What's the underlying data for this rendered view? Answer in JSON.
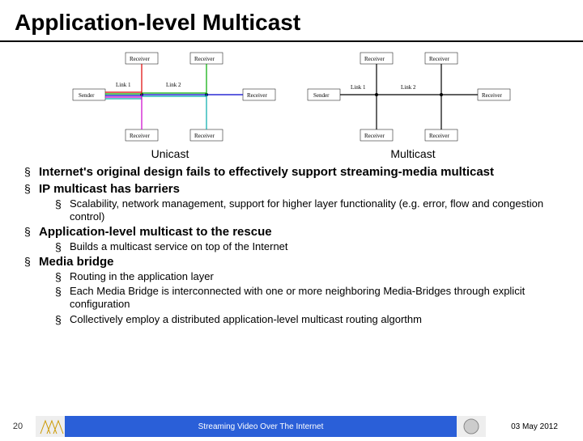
{
  "title": "Application-level Multicast",
  "diagrams": {
    "unicast_caption": "Unicast",
    "multicast_caption": "Multicast",
    "nodes": {
      "sender": "Sender",
      "receiver": "Receiver",
      "link1": "Link 1",
      "link2": "Link 2"
    }
  },
  "bullets": [
    {
      "text": "Internet's original design fails to effectively support streaming-media multicast",
      "children": []
    },
    {
      "text": "IP multicast has barriers",
      "children": [
        {
          "text": "Scalability, network management, support for higher layer functionality (e.g. error, flow and congestion control)"
        }
      ]
    },
    {
      "text": "Application-level multicast to the rescue",
      "children": [
        {
          "text": "Builds a multicast service on top of the Internet"
        }
      ]
    },
    {
      "text": "Media bridge",
      "children": [
        {
          "text": "Routing in the application layer"
        },
        {
          "text": "Each Media Bridge is interconnected with one or more neighboring Media-Bridges through explicit configuration"
        },
        {
          "text": "Collectively employ a distributed application-level multicast routing algorthm"
        }
      ]
    }
  ],
  "footer": {
    "page": "20",
    "center": "Streaming Video Over The Internet",
    "date": "03 May 2012"
  }
}
